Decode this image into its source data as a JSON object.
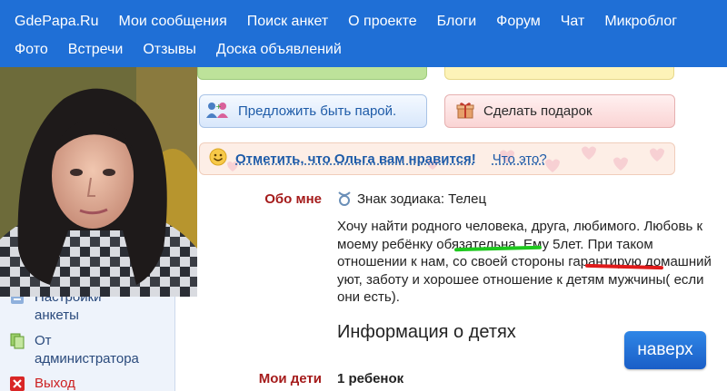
{
  "nav": {
    "row1": [
      "GdePapa.Ru",
      "Мои сообщения",
      "Поиск анкет",
      "О проекте",
      "Блоги",
      "Форум",
      "Чат",
      "Микроблог"
    ],
    "row2": [
      "Фото",
      "Встречи",
      "Отзывы",
      "Доска объявлений"
    ]
  },
  "sidebar": {
    "settings_label": "Настройки\nанкеты",
    "settings_line1": "Настройки",
    "settings_line2": "анкеты",
    "admin_line1": "От",
    "admin_line2": "администратора",
    "exit_label": "Выход"
  },
  "actions": {
    "pair_label": "Предложить быть парой.",
    "gift_label": "Сделать подарок",
    "like_label": "Отметить, что Ольга вам нравится!",
    "what_label": "Что это?"
  },
  "about": {
    "label": "Обо мне",
    "zodiac": "Знак зодиака: Телец",
    "text": "Хочу найти родного человека, друга, любимого. Любовь к моему ребёнку обязательна. Ему 5лет. При таком отношении к нам, со своей стороны гарантирую домашний уют, заботу и хорошее отношение к детям мужчины( если они есть)."
  },
  "children": {
    "section_title": "Информация о детях",
    "label": "Мои дети",
    "value": "1 ребенок"
  },
  "up_button": "наверх",
  "colors": {
    "nav_bg": "#1f6fd6",
    "label_red": "#a51b1b",
    "link_blue": "#1e5ba8",
    "green_mark": "#1ec81e",
    "red_mark": "#e01b1b"
  }
}
